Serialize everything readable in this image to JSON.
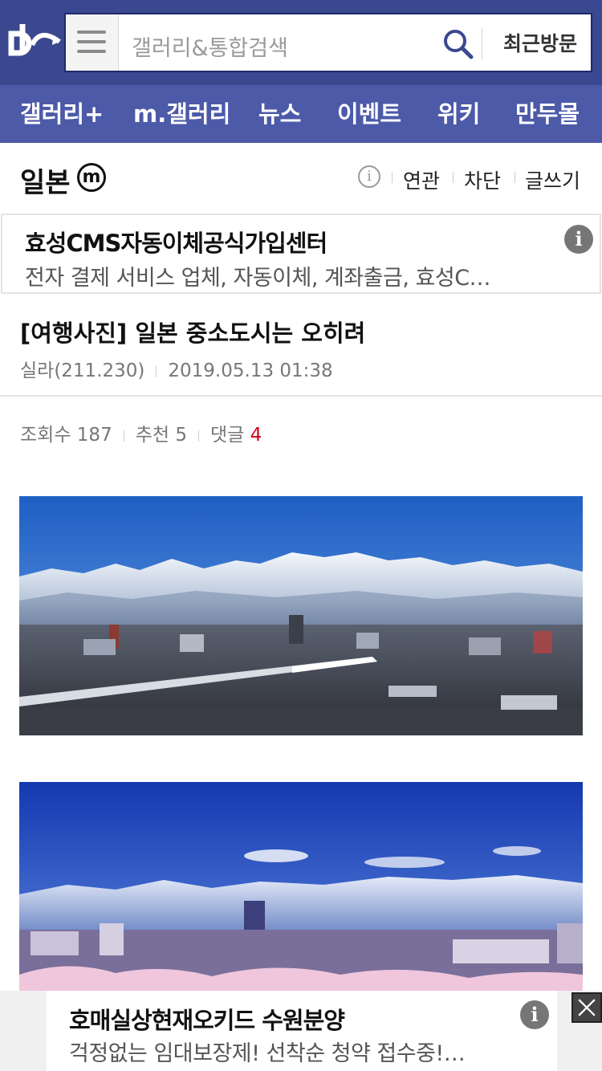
{
  "header": {
    "search_placeholder": "갤러리&통합검색",
    "recent_label": "최근방문"
  },
  "nav": {
    "items": [
      "갤러리+",
      "m.갤러리",
      "뉴스",
      "이벤트",
      "위키",
      "만두몰"
    ]
  },
  "gallery": {
    "title": "일본",
    "minor_badge": "m",
    "info_glyph": "i",
    "links": [
      "연관",
      "차단",
      "글쓰기"
    ]
  },
  "ad_top": {
    "title": "효성CMS자동이체공식가입센터",
    "description": "전자 결제 서비스 업체, 자동이체, 계좌출금, 효성C…",
    "info_glyph": "i"
  },
  "post": {
    "title": "[여행사진] 일본 중소도시는 오히려",
    "author": "실라(211.230)",
    "datetime": "2019.05.13 01:38",
    "views_label": "조회수",
    "views": "187",
    "recommend_label": "추천",
    "recommend": "5",
    "comments_label": "댓글",
    "comments": "4"
  },
  "ad_bottom": {
    "title": "호매실상현재오키드 수원분양",
    "description": "걱정없는 임대보장제! 선착순 청약 접수중!…",
    "info_glyph": "i"
  },
  "colors": {
    "header_bg": "#3b4890",
    "nav_bg": "#4c5aa8",
    "accent_red": "#d0021b"
  }
}
